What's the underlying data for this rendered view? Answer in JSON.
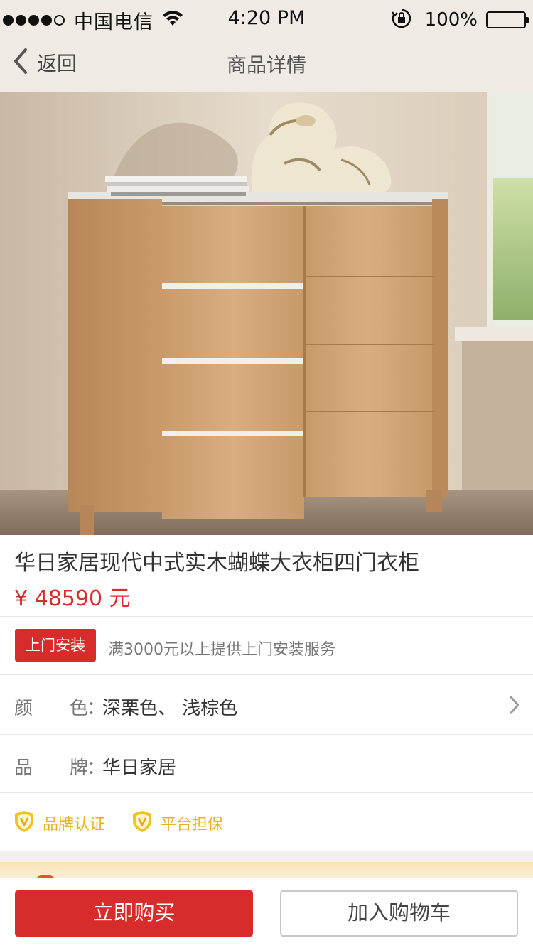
{
  "status_bar": {
    "carrier": "中国电信",
    "time": "4:20 PM",
    "battery": "100%",
    "signal_bars": 4
  },
  "nav": {
    "back_label": "返回",
    "title": "商品详情"
  },
  "product": {
    "title": "华日家居现代中式实木蝴蝶大衣柜四门衣柜",
    "price": "¥  48590 元"
  },
  "install": {
    "badge": "上门安装",
    "note": "满3000元以上提供上门安装服务"
  },
  "attributes": {
    "color_label": "颜　　色",
    "color_value": "深栗色、 浅棕色",
    "brand_label": "品　　牌",
    "brand_value": "华日家居",
    "colon": "："
  },
  "guarantees": [
    {
      "label": "品牌认证",
      "icon": "shield-v-icon"
    },
    {
      "label": "平台担保",
      "icon": "shield-v-icon"
    }
  ],
  "actions": {
    "buy_now": "立即购买",
    "add_to_cart": "加入购物车"
  },
  "colors": {
    "accent_red": "#d82c2c",
    "guarantee_gold": "#e8b21a",
    "header_bg": "#efebe4"
  }
}
